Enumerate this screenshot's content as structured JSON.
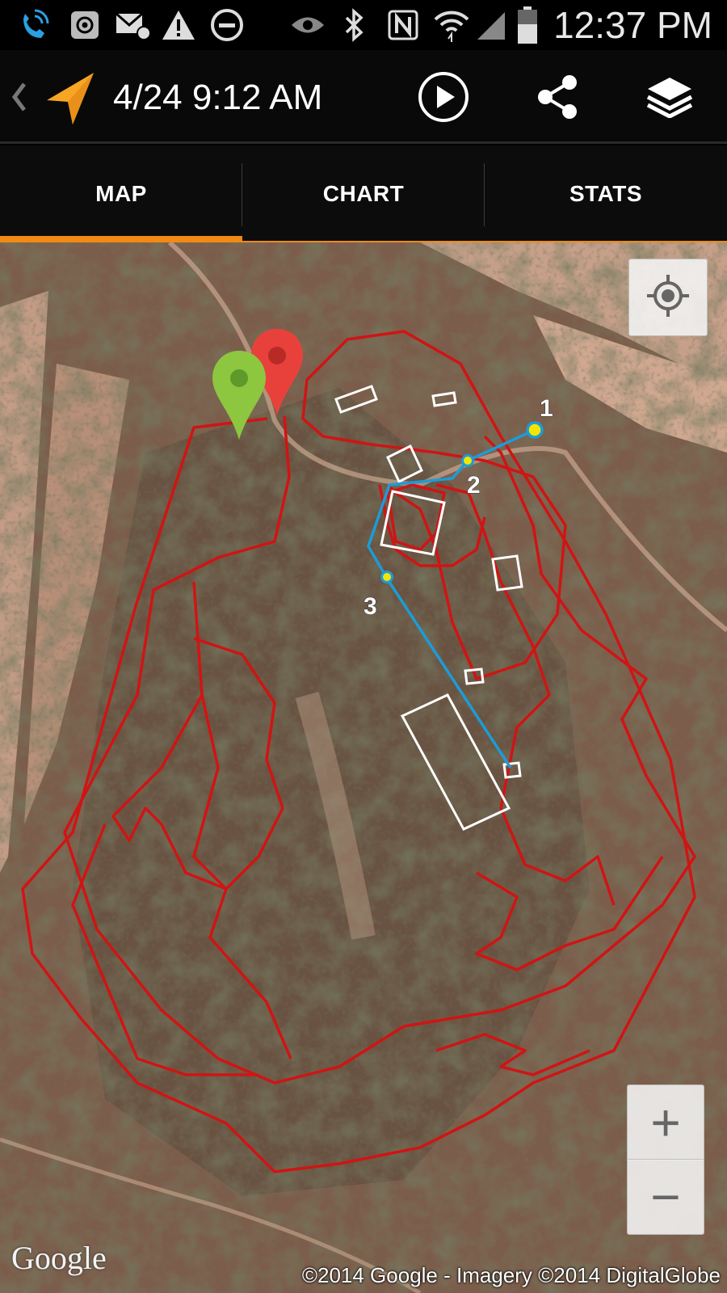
{
  "status_bar": {
    "time": "12:37 PM",
    "icons": [
      "wifi-calling-icon",
      "at-sign-icon",
      "email-icon",
      "warning-icon",
      "do-not-disturb-icon",
      "eye-icon",
      "bluetooth-icon",
      "nfc-icon",
      "wifi-icon",
      "signal-icon",
      "battery-icon"
    ]
  },
  "action_bar": {
    "title": "4/24 9:12 AM",
    "buttons": [
      "play-icon",
      "share-icon",
      "layers-icon"
    ]
  },
  "tabs": [
    {
      "label": "MAP",
      "active": true
    },
    {
      "label": "CHART",
      "active": false
    },
    {
      "label": "STATS",
      "active": false
    }
  ],
  "map": {
    "waypoints": [
      "1",
      "2",
      "3"
    ],
    "google_logo": "Google",
    "attribution": "©2014 Google - Imagery ©2014 DigitalGlobe",
    "zoom_in": "+",
    "zoom_out": "−",
    "colors": {
      "track": "#d01414",
      "route": "#1e9bd7",
      "start_pin": "#8dc63f",
      "end_pin": "#e8413c",
      "accent": "#f08a14"
    }
  }
}
